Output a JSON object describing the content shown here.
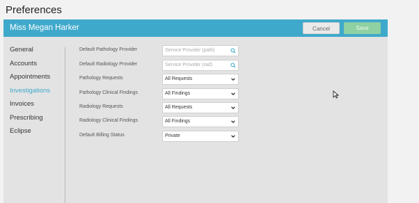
{
  "page": {
    "title": "Preferences"
  },
  "header": {
    "user_name": "Miss Megan Harker",
    "cancel_label": "Cancel",
    "save_label": "Save"
  },
  "sidebar": {
    "items": [
      {
        "label": "General"
      },
      {
        "label": "Accounts"
      },
      {
        "label": "Appointments"
      },
      {
        "label": "Investigations",
        "active": true
      },
      {
        "label": "Invoices"
      },
      {
        "label": "Prescribing"
      },
      {
        "label": "Eclipse"
      }
    ]
  },
  "form": {
    "pathology_provider": {
      "label": "Default Pathology Provider",
      "placeholder": "Service Provider (path)",
      "icon": "search-icon"
    },
    "radiology_provider": {
      "label": "Default Radiology Provider",
      "placeholder": "Service Provider (rad)",
      "icon": "search-icon"
    },
    "pathology_requests": {
      "label": "Pathology Requests",
      "value": "All Requests"
    },
    "pathology_findings": {
      "label": "Pathology Clinical Findings",
      "value": "All Findings"
    },
    "radiology_requests": {
      "label": "Radiology Requests",
      "value": "All Requests"
    },
    "radiology_findings": {
      "label": "Radiology Clinical Findings",
      "value": "All Findings"
    },
    "billing_status": {
      "label": "Default Billing Status",
      "value": "Private"
    }
  },
  "colors": {
    "header": "#3fa9cb",
    "save_button": "#8fd1a2",
    "active_nav": "#3fa9cb"
  }
}
